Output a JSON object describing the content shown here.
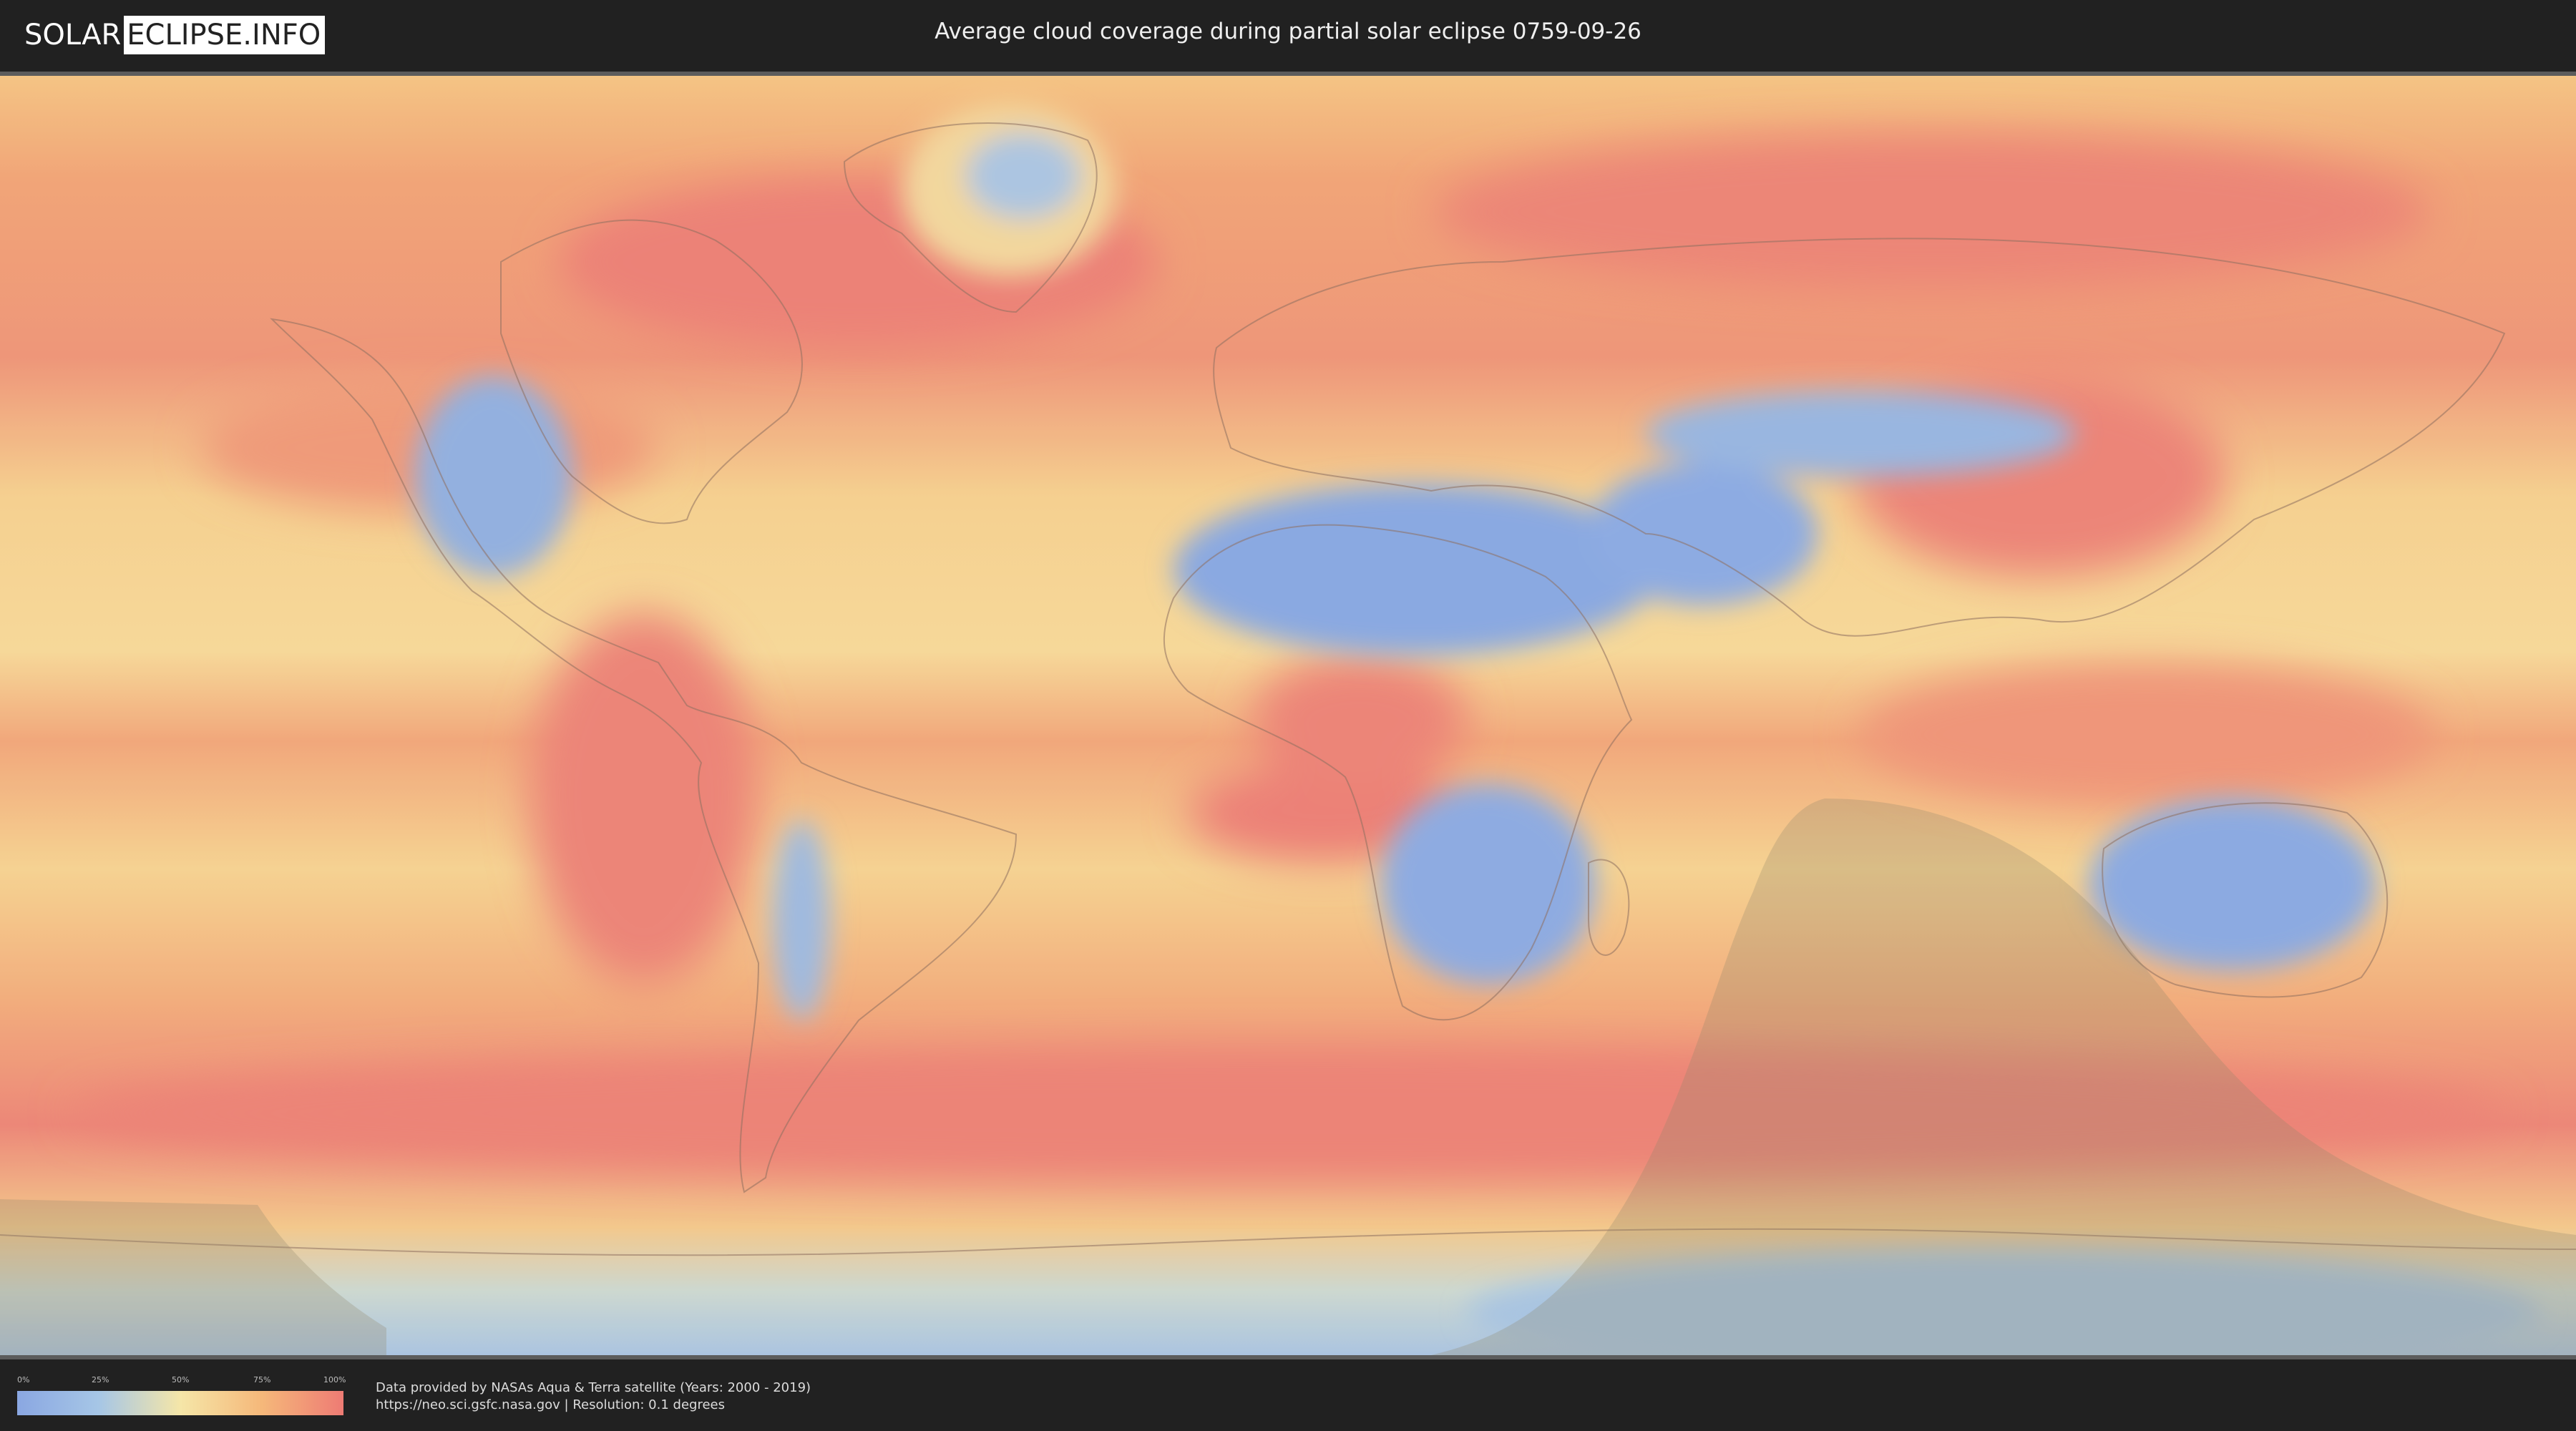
{
  "header": {
    "logo_left": "SOLAR",
    "logo_right": "ECLIPSE.INFO",
    "title": "Average cloud coverage during partial solar eclipse 0759-09-26"
  },
  "legend": {
    "ticks": [
      "0%",
      "25%",
      "50%",
      "75%",
      "100%"
    ],
    "gradient_colors": [
      "#8aa7e2",
      "#a6c6e6",
      "#f5e6a8",
      "#f5b87a",
      "#ee7b74"
    ]
  },
  "credits": {
    "line1": "Data provided by NASAs Aqua & Terra satellite (Years: 2000 - 2019)",
    "line2": "https://neo.sci.gsfc.nasa.gov | Resolution: 0.1 degrees"
  },
  "map": {
    "colors": {
      "clear": "#86a6e0",
      "mid": "#f3dd9c",
      "cloudy": "#ec7f72",
      "eclipse_shade": "#8c8064"
    }
  }
}
